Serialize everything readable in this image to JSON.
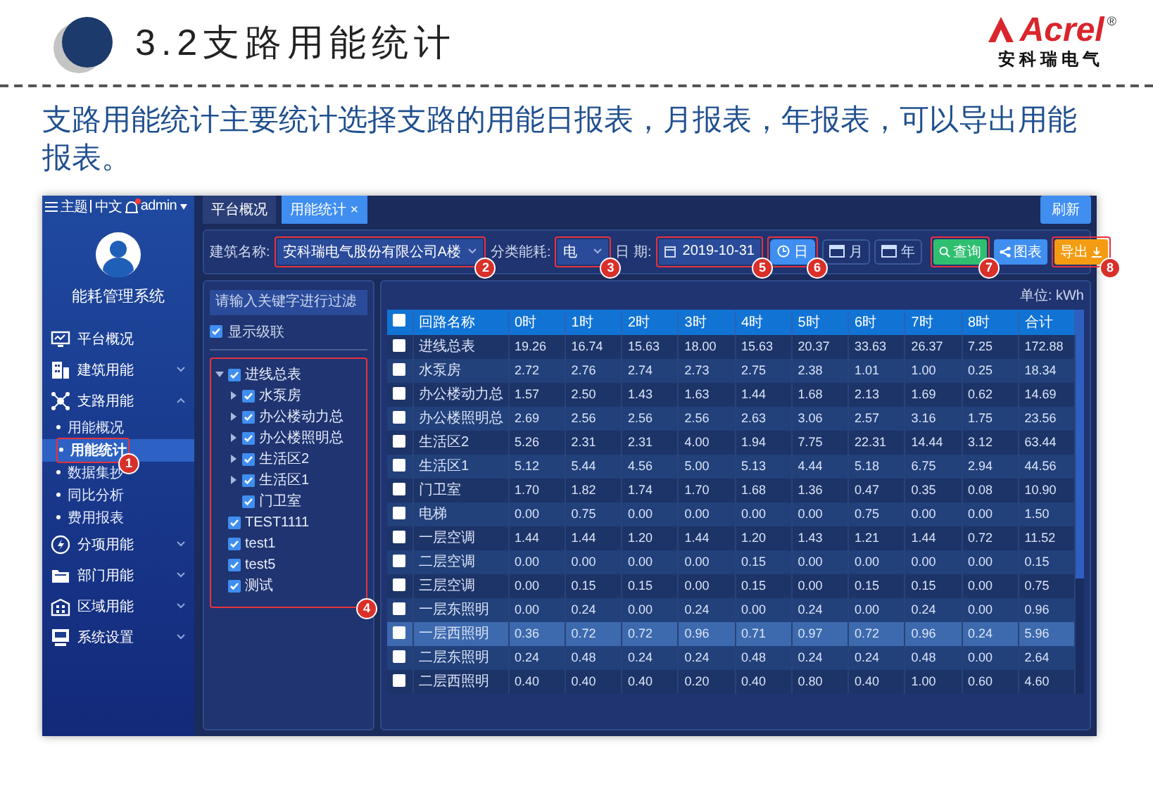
{
  "slide": {
    "title": "3.2支路用能统计",
    "logo": {
      "name": "Acrel",
      "mark": "®",
      "subtitle": "安科瑞电气"
    },
    "description": "支路用能统计主要统计选择支路的用能日报表，月报表，年报表，可以导出用能报表。"
  },
  "app": {
    "top_bar": {
      "theme": "主题",
      "language": "中文",
      "user": "admin",
      "notification": true
    },
    "sidebar": {
      "title": "能耗管理系统",
      "items": [
        {
          "label": "平台概况"
        },
        {
          "label": "建筑用能",
          "expanded": false
        },
        {
          "label": "支路用能",
          "expanded": true,
          "children": [
            {
              "label": "用能概况",
              "selected": false
            },
            {
              "label": "用能统计",
              "selected": true,
              "callout": "1"
            },
            {
              "label": "数据集抄",
              "selected": false
            },
            {
              "label": "同比分析",
              "selected": false
            },
            {
              "label": "费用报表",
              "selected": false
            }
          ]
        },
        {
          "label": "分项用能",
          "expanded": false
        },
        {
          "label": "部门用能",
          "expanded": false
        },
        {
          "label": "区域用能",
          "expanded": false
        },
        {
          "label": "系统设置",
          "expanded": false
        }
      ]
    },
    "tabs": [
      {
        "label": "平台概况",
        "selected": false
      },
      {
        "label": "用能统计",
        "close": "×",
        "selected": true
      }
    ],
    "refresh_button": "刷新",
    "filters": {
      "building_label": "建筑名称:",
      "building": {
        "value": "安科瑞电气股份有限公司A楼",
        "callout": "2"
      },
      "category_label": "分类能耗:",
      "category": {
        "value": "电",
        "callout": "3"
      },
      "date_label": "日 期:",
      "date": {
        "value": "2019-10-31",
        "callout": "5"
      },
      "periods": [
        {
          "label": "日",
          "selected": true,
          "callout": "6"
        },
        {
          "label": "月",
          "selected": false
        },
        {
          "label": "年",
          "selected": false
        }
      ],
      "actions": [
        {
          "kind": "search",
          "label": "查询",
          "callout": "7"
        },
        {
          "kind": "chart",
          "label": "图表"
        },
        {
          "kind": "export",
          "label": "导出",
          "callout": "8"
        }
      ]
    },
    "tree_panel": {
      "placeholder": "请输入关键字进行过滤",
      "cascade": {
        "label": "显示级联",
        "checked": true
      },
      "callout": "4",
      "nodes": [
        {
          "label": "进线总表",
          "checked": true,
          "expanded": true,
          "children": [
            {
              "label": "水泵房",
              "checked": true,
              "expanded": false
            },
            {
              "label": "办公楼动力总",
              "checked": true,
              "expanded": false
            },
            {
              "label": "办公楼照明总",
              "checked": true,
              "expanded": false
            },
            {
              "label": "生活区2",
              "checked": true,
              "expanded": false
            },
            {
              "label": "生活区1",
              "checked": true,
              "expanded": false
            },
            {
              "label": "门卫室",
              "checked": true
            }
          ]
        },
        {
          "label": "TEST1111",
          "checked": true
        },
        {
          "label": "test1",
          "checked": true
        },
        {
          "label": "test5",
          "checked": true
        },
        {
          "label": "测试",
          "checked": true
        }
      ]
    },
    "table": {
      "unit": "单位: kWh",
      "all_checked": false,
      "columns": [
        "回路名称",
        "0时",
        "1时",
        "2时",
        "3时",
        "4时",
        "5时",
        "6时",
        "7时",
        "8时",
        "合计"
      ],
      "rows": [
        {
          "checked": false,
          "selected": false,
          "cells": [
            "进线总表",
            "19.26",
            "16.74",
            "15.63",
            "18.00",
            "15.63",
            "20.37",
            "33.63",
            "26.37",
            "7.25",
            "172.88"
          ]
        },
        {
          "checked": false,
          "selected": false,
          "cells": [
            "水泵房",
            "2.72",
            "2.76",
            "2.74",
            "2.73",
            "2.75",
            "2.38",
            "1.01",
            "1.00",
            "0.25",
            "18.34"
          ]
        },
        {
          "checked": false,
          "selected": false,
          "cells": [
            "办公楼动力总",
            "1.57",
            "2.50",
            "1.43",
            "1.63",
            "1.44",
            "1.68",
            "2.13",
            "1.69",
            "0.62",
            "14.69"
          ]
        },
        {
          "checked": false,
          "selected": false,
          "cells": [
            "办公楼照明总",
            "2.69",
            "2.56",
            "2.56",
            "2.56",
            "2.63",
            "3.06",
            "2.57",
            "3.16",
            "1.75",
            "23.56"
          ]
        },
        {
          "checked": false,
          "selected": false,
          "cells": [
            "生活区2",
            "5.26",
            "2.31",
            "2.31",
            "4.00",
            "1.94",
            "7.75",
            "22.31",
            "14.44",
            "3.12",
            "63.44"
          ]
        },
        {
          "checked": false,
          "selected": false,
          "cells": [
            "生活区1",
            "5.12",
            "5.44",
            "4.56",
            "5.00",
            "5.13",
            "4.44",
            "5.18",
            "6.75",
            "2.94",
            "44.56"
          ]
        },
        {
          "checked": false,
          "selected": false,
          "cells": [
            "门卫室",
            "1.70",
            "1.82",
            "1.74",
            "1.70",
            "1.68",
            "1.36",
            "0.47",
            "0.35",
            "0.08",
            "10.90"
          ]
        },
        {
          "checked": false,
          "selected": false,
          "cells": [
            "电梯",
            "0.00",
            "0.75",
            "0.00",
            "0.00",
            "0.00",
            "0.00",
            "0.75",
            "0.00",
            "0.00",
            "1.50"
          ]
        },
        {
          "checked": false,
          "selected": false,
          "cells": [
            "一层空调",
            "1.44",
            "1.44",
            "1.20",
            "1.44",
            "1.20",
            "1.43",
            "1.21",
            "1.44",
            "0.72",
            "11.52"
          ]
        },
        {
          "checked": false,
          "selected": false,
          "cells": [
            "二层空调",
            "0.00",
            "0.00",
            "0.00",
            "0.00",
            "0.15",
            "0.00",
            "0.00",
            "0.00",
            "0.00",
            "0.15"
          ]
        },
        {
          "checked": false,
          "selected": false,
          "cells": [
            "三层空调",
            "0.00",
            "0.15",
            "0.15",
            "0.00",
            "0.15",
            "0.00",
            "0.15",
            "0.15",
            "0.00",
            "0.75"
          ]
        },
        {
          "checked": false,
          "selected": false,
          "cells": [
            "一层东照明",
            "0.00",
            "0.24",
            "0.00",
            "0.24",
            "0.00",
            "0.24",
            "0.00",
            "0.24",
            "0.00",
            "0.96"
          ]
        },
        {
          "checked": false,
          "selected": true,
          "cells": [
            "一层西照明",
            "0.36",
            "0.72",
            "0.72",
            "0.96",
            "0.71",
            "0.97",
            "0.72",
            "0.96",
            "0.24",
            "5.96"
          ]
        },
        {
          "checked": false,
          "selected": false,
          "cells": [
            "二层东照明",
            "0.24",
            "0.48",
            "0.24",
            "0.24",
            "0.48",
            "0.24",
            "0.24",
            "0.48",
            "0.00",
            "2.64"
          ]
        },
        {
          "checked": false,
          "selected": false,
          "cells": [
            "二层西照明",
            "0.40",
            "0.40",
            "0.40",
            "0.20",
            "0.40",
            "0.80",
            "0.40",
            "1.00",
            "0.60",
            "4.60"
          ]
        }
      ]
    }
  }
}
